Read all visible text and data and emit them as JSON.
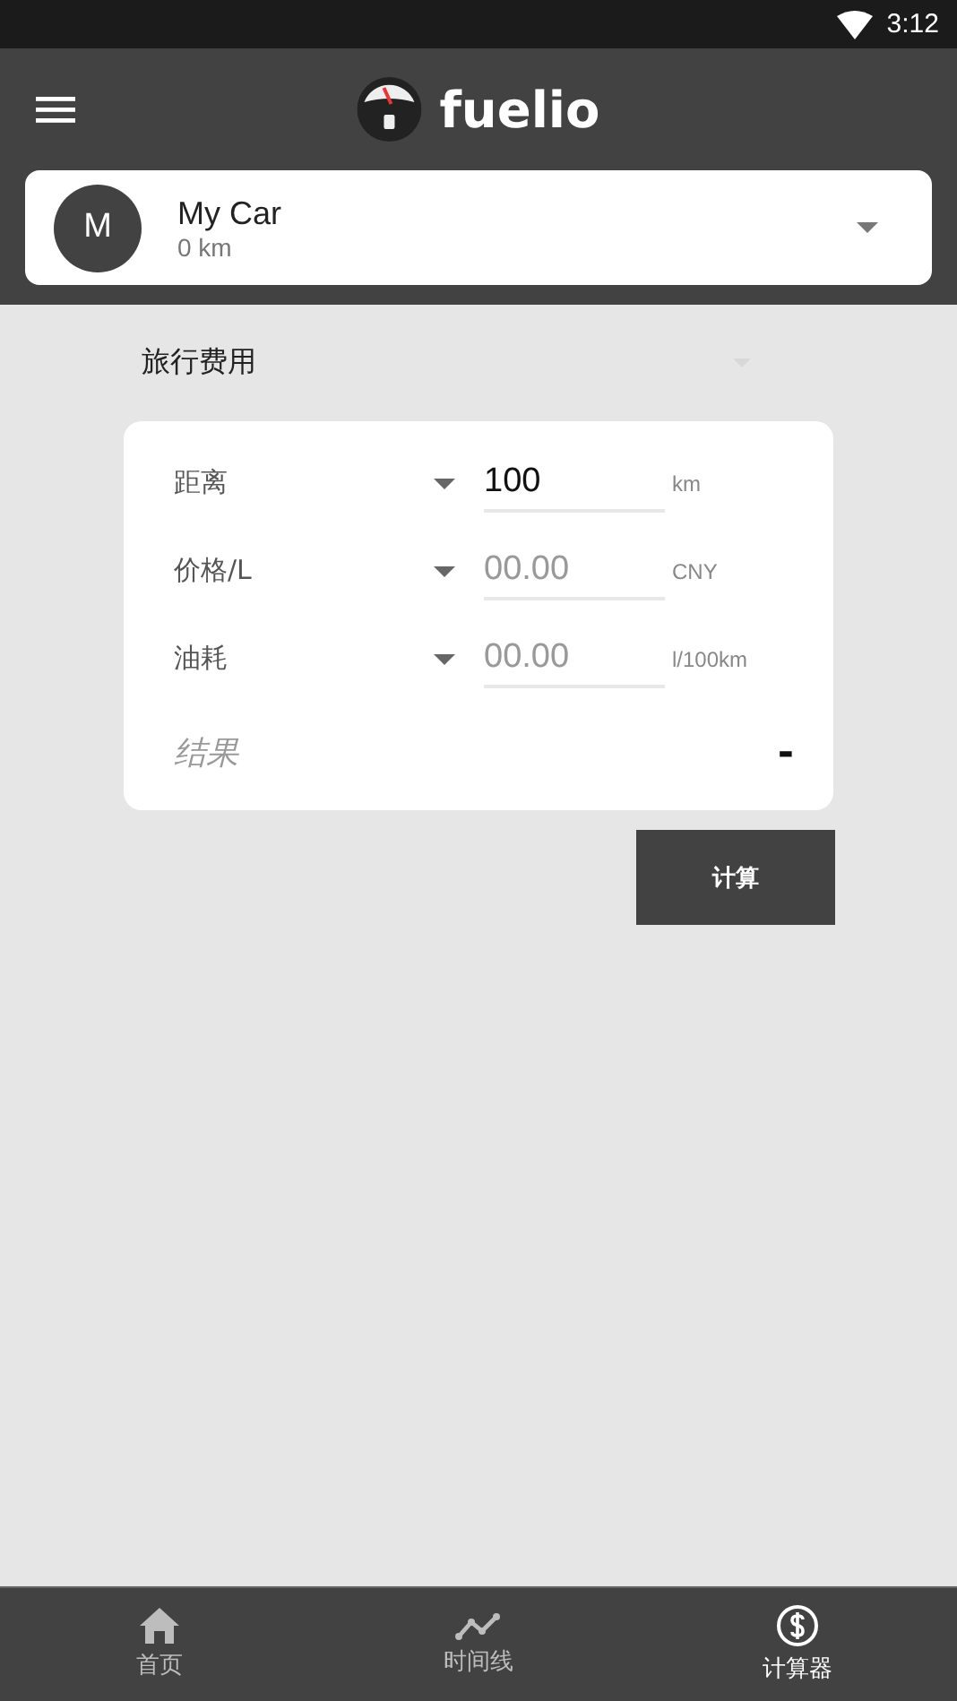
{
  "status_bar": {
    "time": "3:12"
  },
  "app_bar": {
    "title": "fuelio"
  },
  "vehicle": {
    "initial": "M",
    "name": "My Car",
    "odometer": "0 km"
  },
  "calculator_type": "旅行费用",
  "fields": [
    {
      "label": "距离",
      "value": "100",
      "unit": "km"
    },
    {
      "label": "价格/L",
      "placeholder": "00.00",
      "unit": "CNY"
    },
    {
      "label": "油耗",
      "placeholder": "00.00",
      "unit": "l/100km"
    }
  ],
  "result": {
    "label": "结果",
    "value": "-"
  },
  "calculate_button": "计算",
  "bottom_nav": [
    {
      "kind": "home",
      "label": "首页",
      "selected": false
    },
    {
      "kind": "timeline",
      "label": "时间线",
      "selected": false
    },
    {
      "kind": "calculator",
      "label": "计算器",
      "selected": true
    }
  ]
}
